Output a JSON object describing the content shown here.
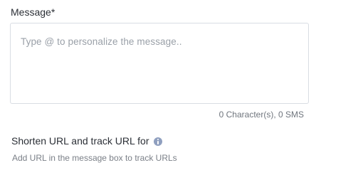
{
  "message": {
    "label": "Message",
    "required_marker": "*",
    "placeholder": "Type @ to personalize the message..",
    "value": "",
    "counter": "0 Character(s), 0 SMS"
  },
  "shorten_url": {
    "title": "Shorten URL and track URL for",
    "info_icon": "info-icon",
    "description": "Add URL in the message box to track URLs"
  },
  "colors": {
    "text": "#2b2f36",
    "muted": "#7a7f87",
    "placeholder": "#9aa0a8",
    "border": "#d9dde3",
    "info_icon": "#8f9fbf"
  }
}
